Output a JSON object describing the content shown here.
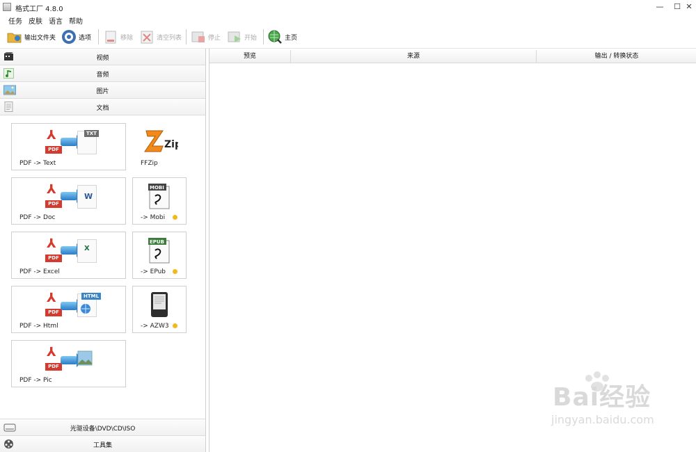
{
  "window": {
    "title": "格式工厂 4.8.0",
    "minimize": "—",
    "maximize": "☐",
    "close": "✕"
  },
  "menu": [
    "任务",
    "皮肤",
    "语言",
    "帮助"
  ],
  "toolbar": {
    "output_folder": "输出文件夹",
    "options": "选项",
    "remove": "移除",
    "clear_list": "清空列表",
    "stop": "停止",
    "start": "开始",
    "home": "主页"
  },
  "categories": {
    "video": "视频",
    "audio": "音频",
    "image": "图片",
    "document": "文档"
  },
  "cards": {
    "pdf_text": {
      "label": "PDF -> Text",
      "from": "PDF",
      "to": "TXT"
    },
    "pdf_doc": {
      "label": "PDF -> Doc",
      "from": "PDF",
      "to": "W"
    },
    "pdf_excel": {
      "label": "PDF -> Excel",
      "from": "PDF",
      "to": "X"
    },
    "pdf_html": {
      "label": "PDF -> Html",
      "from": "PDF",
      "to": "HTML"
    },
    "pdf_pic": {
      "label": "PDF -> Pic",
      "from": "PDF"
    },
    "ffzip": {
      "label": "FFZip",
      "logo": "Zip"
    },
    "mobi": {
      "label": "-> Mobi",
      "tag": "MOBI"
    },
    "epub": {
      "label": "-> EPub",
      "tag": "EPUB"
    },
    "azw3": {
      "label": "-> AZW3"
    }
  },
  "bottom": {
    "optical": "光驱设备\\DVD\\CD\\ISO",
    "tools": "工具集"
  },
  "table": {
    "columns": [
      "预览",
      "来源",
      "输出 / 转换状态"
    ]
  },
  "watermark": {
    "brand": "Bai经验",
    "url": "jingyan.baidu.com"
  },
  "colors": {
    "accent_blue": "#2a7cc7",
    "pdf_red": "#d43b2e",
    "badge_yellow": "#f2b820"
  }
}
